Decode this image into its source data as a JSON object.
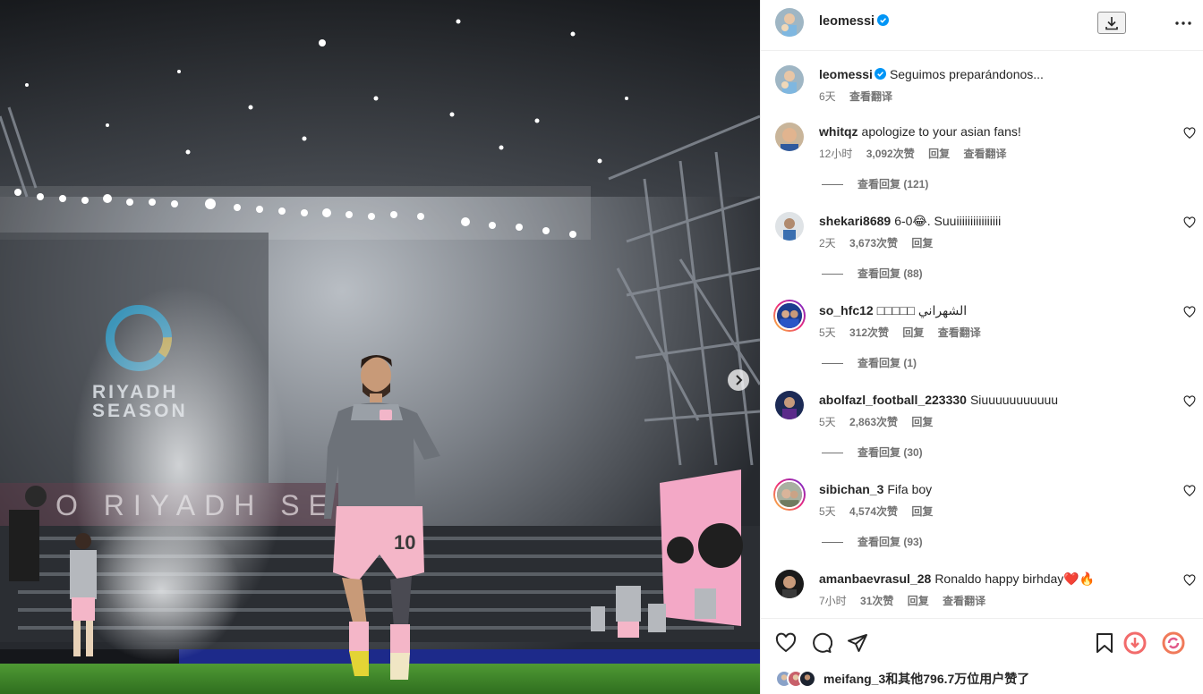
{
  "header": {
    "username": "leomessi"
  },
  "caption": {
    "username": "leomessi",
    "text": "Seguimos preparándonos...",
    "time": "6天",
    "translate": "查看翻译"
  },
  "comments": [
    {
      "user": "whitqz",
      "text": "apologize to your asian fans!",
      "time": "12小时",
      "likes": "3,092次赞",
      "reply": "回复",
      "translate": "查看翻译",
      "replies": "查看回复 (121)"
    },
    {
      "user": "shekari8689",
      "text": "6-0😂. Suuiiiiiiiiiiiiiiii",
      "time": "2天",
      "likes": "3,673次赞",
      "reply": "回复",
      "translate": "",
      "replies": "查看回复 (88)"
    },
    {
      "user": "so_hfc12",
      "text": "□□□□□ الشهراني",
      "time": "5天",
      "likes": "312次赞",
      "reply": "回复",
      "translate": "查看翻译",
      "replies": "查看回复 (1)"
    },
    {
      "user": "abolfazl_football_223330",
      "text": "Siuuuuuuuuuuu",
      "time": "5天",
      "likes": "2,863次赞",
      "reply": "回复",
      "translate": "",
      "replies": "查看回复 (30)"
    },
    {
      "user": "sibichan_3",
      "text": "Fifa boy",
      "time": "5天",
      "likes": "4,574次赞",
      "reply": "回复",
      "translate": "",
      "replies": "查看回复 (93)"
    },
    {
      "user": "amanbaevrasul_28",
      "text": "Ronaldo happy birhday❤️🔥",
      "time": "7小时",
      "likes": "31次赞",
      "reply": "回复",
      "translate": "查看翻译",
      "replies": ""
    }
  ],
  "likes": {
    "user": "meifang_3",
    "rest": "和其他796.7万位用户赞了"
  },
  "photo": {
    "banner_text": "RIYADH SEASON",
    "ticker_text": "O RIYADH SEA",
    "jersey_number": "10"
  },
  "colors": {
    "verified": "#0095f6",
    "text": "#262626",
    "secondary": "#737373",
    "border": "#efefef",
    "pitch": "#3f8a2c",
    "shorts": "#f4b6c8"
  },
  "icons": {
    "download": "download-icon",
    "more": "more-horizontal-icon",
    "like": "heart-icon",
    "comment": "comment-bubble-icon",
    "share": "paper-plane-icon",
    "save": "bookmark-icon",
    "next": "chevron-right-icon"
  }
}
